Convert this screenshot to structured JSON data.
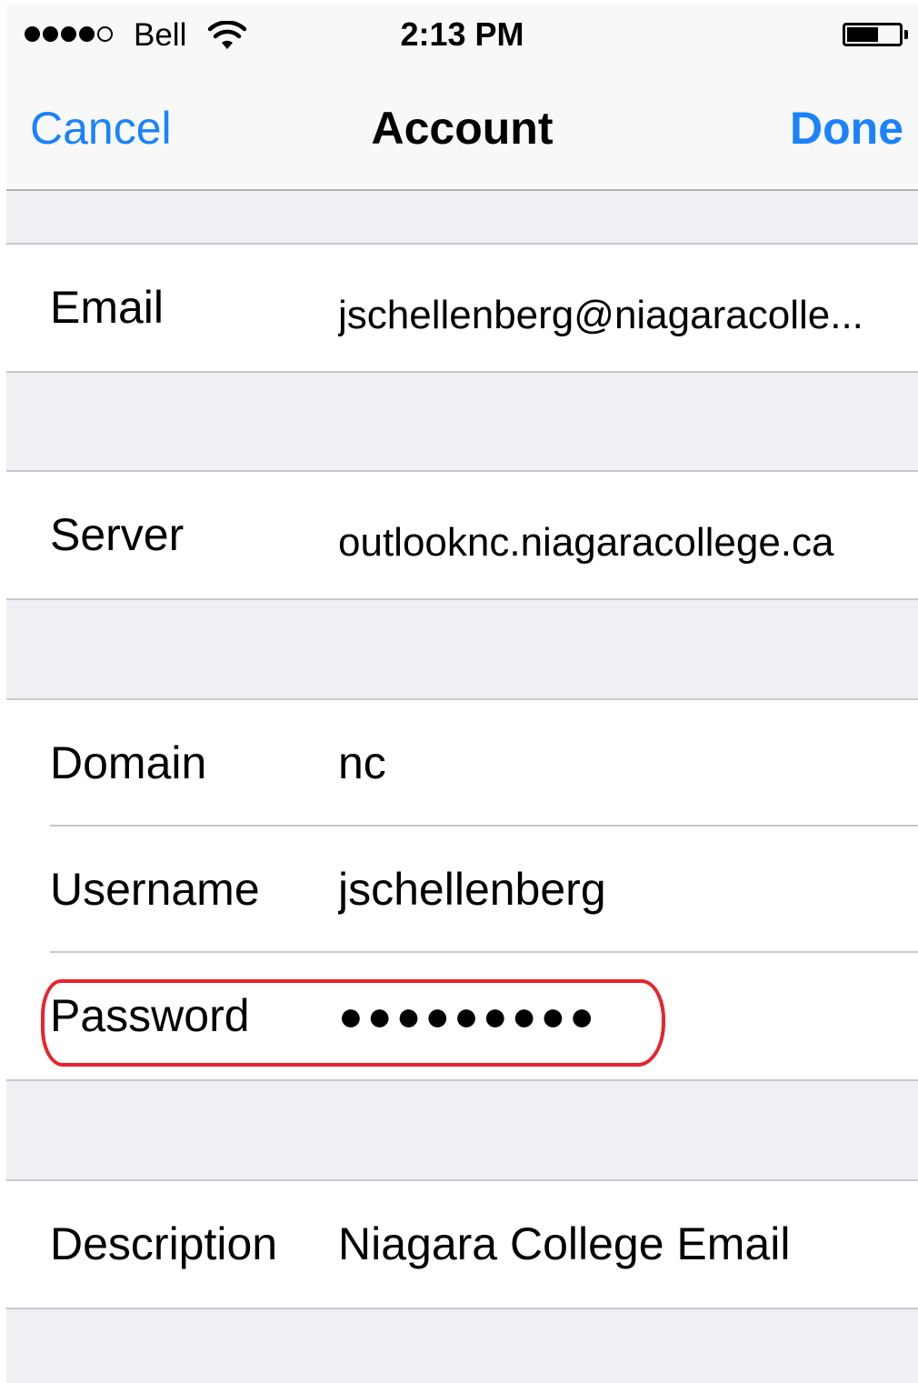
{
  "status_bar": {
    "carrier": "Bell",
    "time": "2:13 PM",
    "signal_bars_filled": 4,
    "signal_bars_total": 5,
    "battery_level": 0.6,
    "icons": [
      "signal-icon",
      "wifi-icon",
      "battery-icon"
    ]
  },
  "nav": {
    "cancel_label": "Cancel",
    "title": "Account",
    "done_label": "Done"
  },
  "account": {
    "email": {
      "label": "Email",
      "value": "jschellenberg@niagaracolle..."
    },
    "server": {
      "label": "Server",
      "value": "outlooknc.niagaracollege.ca"
    },
    "domain": {
      "label": "Domain",
      "value": "nc"
    },
    "username": {
      "label": "Username",
      "value": "jschellenberg"
    },
    "password": {
      "label": "Password",
      "value": "●●●●●●●●●"
    },
    "description": {
      "label": "Description",
      "value": "Niagara College Email"
    }
  },
  "colors": {
    "accent": "#1a82fb",
    "background": "#efeff4",
    "cell": "#ffffff",
    "separator": "#c8c7cc",
    "annotation": "#e8232c"
  }
}
